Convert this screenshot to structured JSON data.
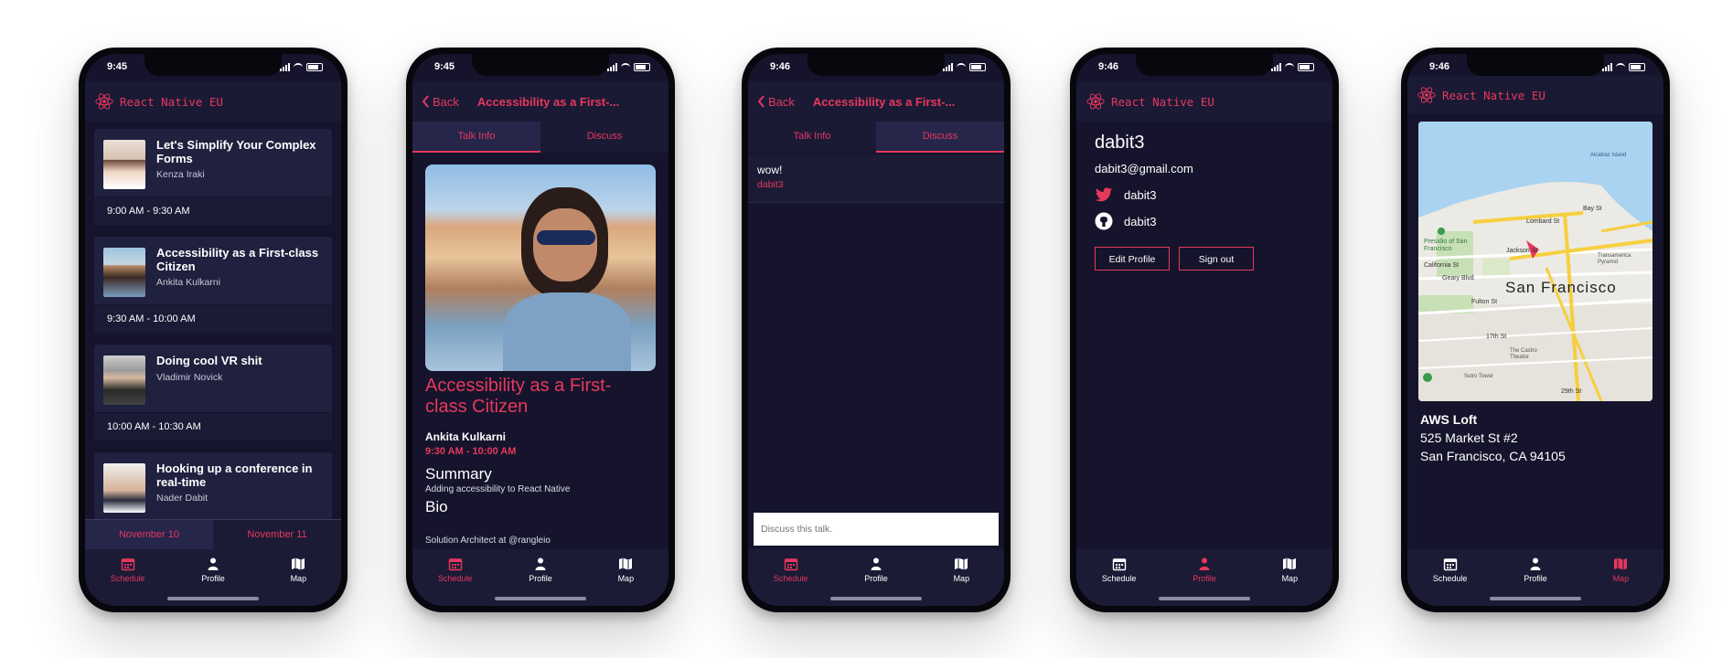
{
  "status_times": [
    "9:45",
    "9:45",
    "9:46",
    "9:46",
    "9:46"
  ],
  "colors": {
    "accent": "#e6385d",
    "background": "#15142c",
    "card": "#20203f"
  },
  "brand": "React Native EU",
  "tabs": {
    "schedule": "Schedule",
    "profile": "Profile",
    "map": "Map"
  },
  "schedule": {
    "talks": [
      {
        "title": "Let's Simplify Your Complex Forms",
        "speaker": "Kenza Iraki",
        "time": "9:00 AM - 9:30 AM"
      },
      {
        "title": "Accessibility as a First-class Citizen",
        "speaker": "Ankita Kulkarni",
        "time": "9:30 AM - 10:00 AM"
      },
      {
        "title": "Doing cool VR shit",
        "speaker": "Vladimir Novick",
        "time": "10:00 AM - 10:30 AM"
      },
      {
        "title": "Hooking up a conference in real-time",
        "speaker": "Nader Dabit",
        "time": ""
      }
    ],
    "days": [
      "November 10",
      "November 11"
    ]
  },
  "talk": {
    "back": "Back",
    "nav_title": "Accessibility as a First-...",
    "tab_info": "Talk Info",
    "tab_discuss": "Discuss",
    "title": "Accessibility as a First-class Citizen",
    "speaker": "Ankita Kulkarni",
    "time": "9:30 AM - 10:00 AM",
    "summary_heading": "Summary",
    "summary": "Adding accessibility to React Native",
    "bio_heading": "Bio",
    "bio": "Solution Architect at @rangleio"
  },
  "discuss": {
    "message": "wow!",
    "author": "dabit3",
    "placeholder": "Discuss this talk."
  },
  "profile": {
    "username": "dabit3",
    "email": "dabit3@gmail.com",
    "twitter": "dabit3",
    "github": "dabit3",
    "edit_label": "Edit Profile",
    "signout_label": "Sign out"
  },
  "map": {
    "city_label": "San Francisco",
    "street_labels": [
      "California St",
      "Geary Blvd",
      "Fulton St",
      "Lombard St",
      "Jackson St",
      "Bay St",
      "17th St",
      "29th St"
    ],
    "poi_labels": [
      "Presidio of San Francisco",
      "Transamerica Pyramid",
      "The Castro Theatre",
      "Sutro Tower",
      "Alcatraz Island"
    ],
    "venue_name": "AWS Loft",
    "address_line1": "525 Market St #2",
    "address_line2": "San Francisco, CA 94105"
  }
}
